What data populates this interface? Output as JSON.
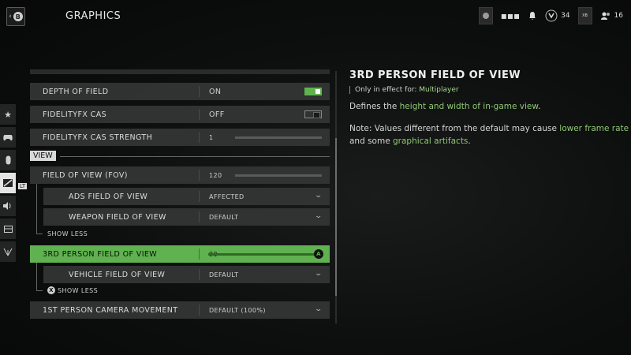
{
  "header": {
    "back_label": "B",
    "title": "GRAPHICS",
    "icons": [
      "record-icon",
      "grid-icon",
      "bell-icon",
      "level-icon",
      "box-icon",
      "friends-icon"
    ],
    "level_count": "34",
    "box_label": "XB",
    "friends_count": "16"
  },
  "sidebar": {
    "items": [
      "star-icon",
      "controller-icon",
      "mouse-icon",
      "graphics-icon",
      "audio-icon",
      "interface-icon",
      "network-icon"
    ],
    "active_index": 3,
    "tag": "LT"
  },
  "settings": {
    "rows": [
      {
        "label": "DEPTH OF FIELD",
        "value": "ON",
        "control": "toggle-on"
      },
      {
        "label": "FIDELITYFX CAS",
        "value": "OFF",
        "control": "toggle-off"
      },
      {
        "label": "FIDELITYFX CAS STRENGTH",
        "value": "1",
        "control": "slider",
        "level": 0.0
      }
    ],
    "section_view": "VIEW",
    "fov": {
      "label": "FIELD OF VIEW (FOV)",
      "value": "120",
      "level": 1.0
    },
    "ads_fov": {
      "label": "ADS FIELD OF VIEW",
      "value": "AFFECTED"
    },
    "weapon_fov": {
      "label": "WEAPON FIELD OF VIEW",
      "value": "DEFAULT"
    },
    "show_less_1": "SHOW LESS",
    "third_person_fov": {
      "label": "3RD PERSON FIELD OF VIEW",
      "value": "90",
      "level": 1.0,
      "knob": "A"
    },
    "vehicle_fov": {
      "label": "VEHICLE FIELD OF VIEW",
      "value": "DEFAULT"
    },
    "show_less_2": "SHOW LESS",
    "show_less_2_btn": "X",
    "camera_movement": {
      "label": "1ST PERSON CAMERA MOVEMENT",
      "value": "DEFAULT (100%)"
    }
  },
  "info": {
    "title": "3RD PERSON FIELD OF VIEW",
    "effect_prefix": "Only in effect for: ",
    "effect_mode": "Multiplayer",
    "desc_prefix": "Defines the ",
    "desc_highlight": "height and width of in-game view",
    "desc_suffix": ".",
    "note_prefix": "Note: Values different from the default may cause ",
    "note_highlight1": "lower frame rate",
    "note_mid": " and some ",
    "note_highlight2": "graphical artifacts",
    "note_suffix": "."
  },
  "colors": {
    "accent": "#5fb24f",
    "highlight_text": "#8ec874"
  }
}
